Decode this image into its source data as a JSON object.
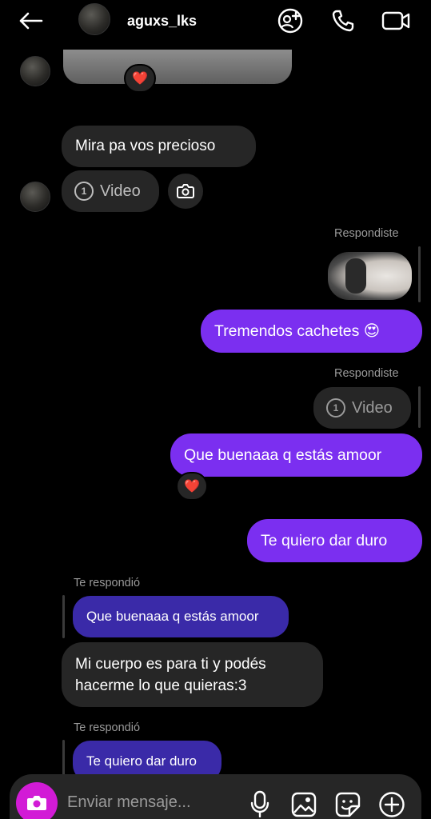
{
  "header": {
    "username": "aguxs_lks",
    "back_icon": "arrow-left-icon",
    "icons": [
      "add-people-icon",
      "phone-icon",
      "video-camera-icon"
    ]
  },
  "messages": {
    "reaction_heart_1": "❤️",
    "msg_mira": "Mira pa vos precioso",
    "video_label_1": "Video",
    "video_count_1": "1",
    "respondiste_1": "Respondiste",
    "msg_tremendos": "Tremendos cachetes 😍",
    "respondiste_2": "Respondiste",
    "video_label_2": "Video",
    "video_count_2": "1",
    "msg_que_buenaaa": "Que buenaaa q estás amoor",
    "reaction_heart_2": "❤️",
    "msg_te_quiero": "Te quiero dar duro",
    "te_respondio_1": "Te respondió",
    "quoted_1": "Que buenaaa q estás amoor",
    "msg_mi_cuerpo_line1": "Mi cuerpo es para ti y podés",
    "msg_mi_cuerpo_line2": "hacerme lo que quieras:3",
    "te_respondio_2": "Te respondió",
    "quoted_2": "Te quiero dar duro"
  },
  "composer": {
    "placeholder": "Enviar mensaje...",
    "icons": [
      "camera-icon",
      "microphone-icon",
      "gallery-icon",
      "sticker-icon",
      "plus-icon"
    ]
  },
  "colors": {
    "background": "#000000",
    "incoming_bubble": "#262626",
    "outgoing_bubble": "#7b2ff0",
    "quoted_bubble": "#3a2aa8",
    "camera_button": "#d21bd6"
  }
}
